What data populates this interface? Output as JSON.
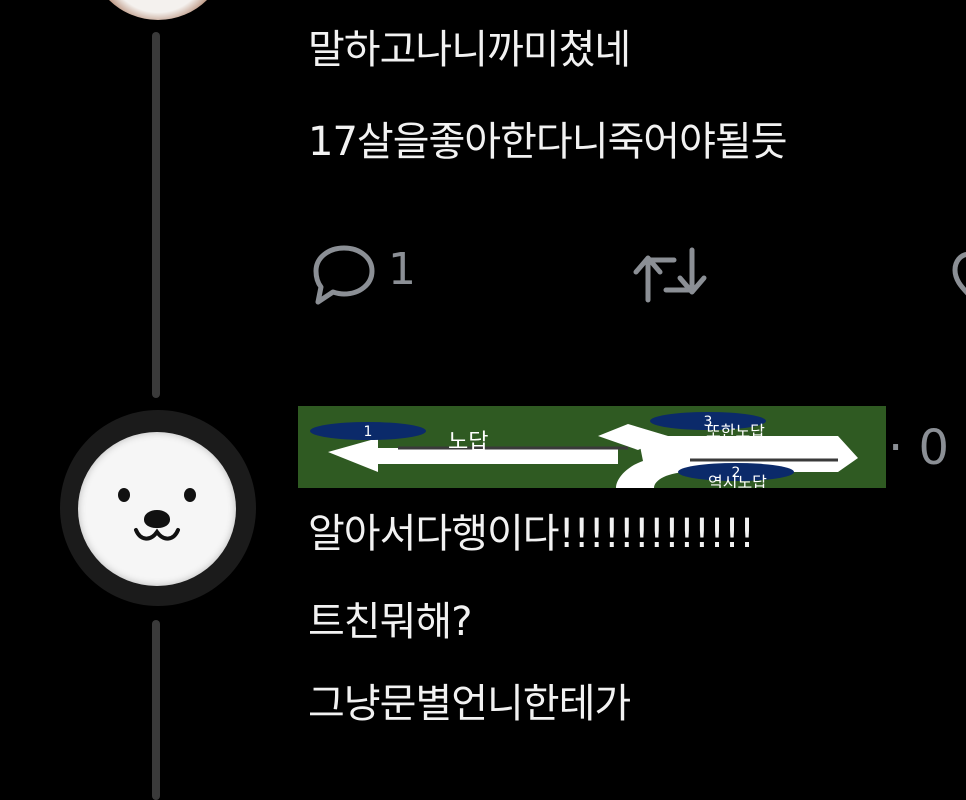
{
  "tweet1": {
    "lines": [
      "말하고나니까미쳤네",
      "17살을좋아한다니죽어야될듯"
    ],
    "reply_count": "1"
  },
  "tweet2": {
    "banner_labels": {
      "n1": "1",
      "n2": "2",
      "n3": "3",
      "left": "노답",
      "right_top": "또한노답",
      "right_bottom": "역시노답"
    },
    "timestamp_partial": "· 0",
    "lines": [
      "알아서다행이다!!!!!!!!!!!!!",
      "트친뭐해?",
      "그냥문별언니한테가"
    ]
  },
  "icons": {
    "reply": "reply-icon",
    "retweet": "retweet-icon",
    "like": "like-icon"
  },
  "colors": {
    "background": "#000000",
    "text": "#f2f2f2",
    "muted": "#8b8f95",
    "thread_line": "#3a3a3a",
    "banner": "#2f5a22"
  }
}
